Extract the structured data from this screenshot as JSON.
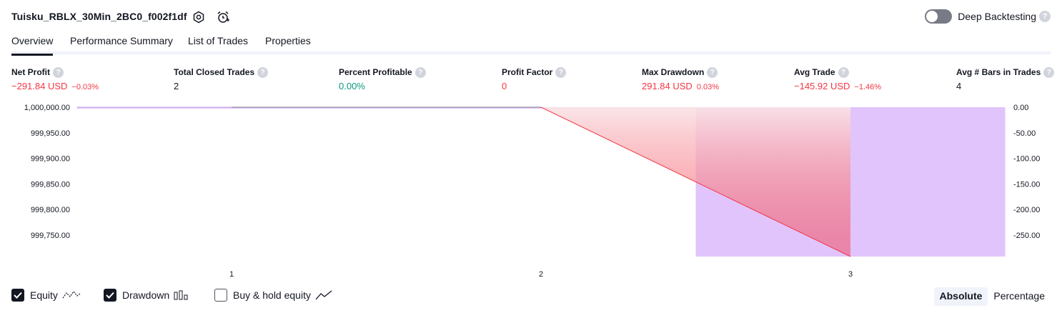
{
  "header": {
    "strategy_name": "Tuisku_RBLX_30Min_2BC0_f002f1df",
    "deep_backtesting_label": "Deep Backtesting",
    "deep_backtesting_on": false,
    "help_glyph": "?"
  },
  "tabs": [
    {
      "label": "Overview",
      "active": true
    },
    {
      "label": "Performance Summary",
      "active": false
    },
    {
      "label": "List of Trades",
      "active": false
    },
    {
      "label": "Properties",
      "active": false
    }
  ],
  "metrics": {
    "net_profit": {
      "label": "Net Profit",
      "value": "−291.84 USD",
      "pct": "−0.03%"
    },
    "total_closed_trades": {
      "label": "Total Closed Trades",
      "value": "2"
    },
    "percent_profitable": {
      "label": "Percent Profitable",
      "value": "0.00%"
    },
    "profit_factor": {
      "label": "Profit Factor",
      "value": "0"
    },
    "max_drawdown": {
      "label": "Max Drawdown",
      "value": "291.84 USD",
      "pct": "0.03%"
    },
    "avg_trade": {
      "label": "Avg Trade",
      "value": "−145.92 USD",
      "pct": "−1.46%"
    },
    "avg_bars": {
      "label": "Avg # Bars in Trades",
      "value": "4"
    }
  },
  "chart_data": {
    "type": "area",
    "x_ticks": [
      "1",
      "2",
      "3"
    ],
    "left_axis": {
      "ticks": [
        "1,000,000.00",
        "999,950.00",
        "999,900.00",
        "999,850.00",
        "999,800.00",
        "999,750.00"
      ],
      "values": [
        1000000,
        999950,
        999900,
        999850,
        999800,
        999750
      ],
      "ylim": [
        999708.16,
        1000000
      ]
    },
    "right_axis": {
      "ticks": [
        "0.00",
        "-50.00",
        "-100.00",
        "-150.00",
        "-200.00",
        "-250.00"
      ],
      "values": [
        0,
        -50,
        -100,
        -150,
        -200,
        -250
      ],
      "ylim": [
        -291.84,
        0
      ]
    },
    "equity": {
      "x": [
        1,
        2,
        3
      ],
      "y": [
        1000000,
        1000000,
        999708.16
      ]
    },
    "drawdown": {
      "x": [
        1,
        2,
        3
      ],
      "y": [
        0,
        0,
        -291.84
      ]
    },
    "colors": {
      "equity_line": "#f23645",
      "equity_fill": "#f7c5cb",
      "drawdown_fill": "#e1c4fb",
      "baseline": "#c3a2ee",
      "grid_line": "#787b86"
    }
  },
  "footer": {
    "equity": {
      "label": "Equity",
      "checked": true
    },
    "drawdown": {
      "label": "Drawdown",
      "checked": true
    },
    "buy_hold": {
      "label": "Buy & hold equity",
      "checked": false
    },
    "absolute_label": "Absolute",
    "percentage_label": "Percentage"
  }
}
